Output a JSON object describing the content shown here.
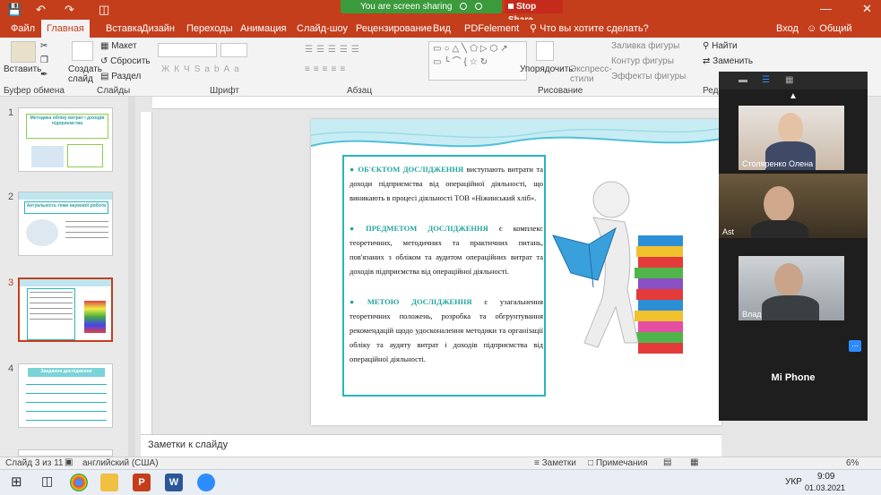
{
  "titlebar": {
    "screen_sharing": "You are screen sharing",
    "stop_share": "Stop Share",
    "qa_icons": [
      "save-icon",
      "undo-icon",
      "redo-icon",
      "start-icon"
    ]
  },
  "tabs": [
    "Файл",
    "Главная",
    "Вставка",
    "Дизайн",
    "Переходы",
    "Анимация",
    "Слайд-шоу",
    "Рецензирование",
    "Вид",
    "PDFelement"
  ],
  "tab_search": "Что вы хотите сделать?",
  "tab_signin": "Вход",
  "tab_share": "Общий доступ",
  "ribbon": {
    "paste": "Вставить",
    "new_slide": "Создать слайд",
    "layout": "Макет",
    "reset": "Сбросить",
    "section": "Раздел",
    "arrange": "Упорядочить",
    "quick_styles": "Экспресс-стили",
    "shape_fill": "Заливка фигуры",
    "shape_outline": "Контур фигуры",
    "shape_effects": "Эффекты фигуры",
    "find": "Найти",
    "replace": "Заменить",
    "groups": {
      "clipboard": "Буфер обмена",
      "slides": "Слайды",
      "font": "Шрифт",
      "paragraph": "Абзац",
      "drawing": "Рисование",
      "editing": "Реда"
    }
  },
  "thumbnails": [
    {
      "num": "1",
      "title": "Методика обліку витрат і доходів підприємства"
    },
    {
      "num": "2",
      "title": "Актуальність теми наукової роботи"
    },
    {
      "num": "3",
      "title": ""
    },
    {
      "num": "4",
      "title": "Завдання дослідження"
    }
  ],
  "slide": {
    "bullets": [
      {
        "head": "ОБ'ЄКТОМ ДОСЛІДЖЕННЯ",
        "text": " виступають витрати та доходи підприємства від операційної діяльності, що виникають в процесі діяльності ТОВ «Ніжинський хліб»."
      },
      {
        "head": "ПРЕДМЕТОМ ДОСЛІДЖЕННЯ",
        "text": " є комплекс теоретичних, методичних та практичних питань, пов'язаних з обліком та аудитом операційних витрат та доходів підприємства від операційної діяльності."
      },
      {
        "head": "МЕТОЮ ДОСЛІДЖЕННЯ",
        "text": " є узагальнення теоретичних положень, розробка та обгрунтування рекомендацій щодо удосконалення методики та організації обліку та аудиту витрат і доходів підприємства від операційної діяльності."
      }
    ]
  },
  "notes_placeholder": "Заметки к слайду",
  "status": {
    "slide_of": "Слайд 3 из 11",
    "language": "английский (США)",
    "notes": "Заметки",
    "comments": "Примечания",
    "zoom": "6%"
  },
  "zoom_panel": {
    "participants": [
      {
        "name": "Столяренко Олена"
      },
      {
        "name": "Ast"
      },
      {
        "name": "Влад"
      }
    ],
    "device": "Mi Phone",
    "more": "..."
  },
  "taskbar": {
    "lang": "УКР",
    "time": "9:09",
    "date": "01.03.2021"
  },
  "colors": {
    "accent": "#c43e1c",
    "teal": "#21a59d",
    "share_green": "#3b9a3b"
  }
}
